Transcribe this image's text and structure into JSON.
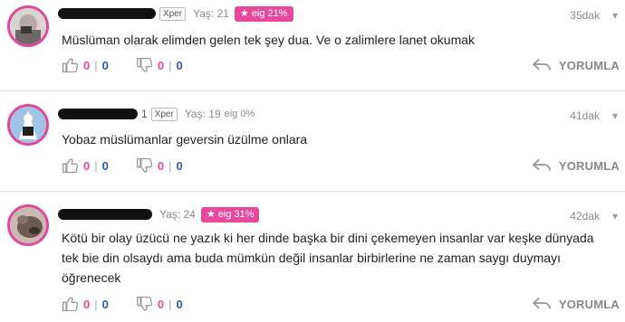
{
  "comments": [
    {
      "badge": "Xper",
      "age": "Yaş: 21",
      "eig": "eig 21%",
      "eig_style": "pill",
      "time": "35dak",
      "text": "Müslüman olarak elimden gelen tek şey dua. Ve o zalimlere lanet okumak",
      "likes": "0",
      "likes_b": "0",
      "dislikes": "0",
      "dislikes_b": "0",
      "reply": "YORUMLA"
    },
    {
      "level": "1",
      "badge": "Xper",
      "age": "Yaş: 19",
      "eig": "eig 0%",
      "eig_style": "plain",
      "time": "41dak",
      "text": "Yobaz müslümanlar geversin üzülme onlara",
      "likes": "0",
      "likes_b": "0",
      "dislikes": "0",
      "dislikes_b": "0",
      "reply": "YORUMLA"
    },
    {
      "age": "Yaş: 24",
      "eig": "eig 31%",
      "eig_style": "pill",
      "time": "42dak",
      "text": "Kötü bir olay üzücü ne yazık ki her dinde başka bir dini çekemeyen insanlar var keşke dünyada tek bie din olsaydı ama buda mümkün değil insanlar birbirlerine ne zaman saygı duymayı öğrenecek",
      "likes": "0",
      "likes_b": "0",
      "dislikes": "0",
      "dislikes_b": "0",
      "reply": "YORUMLA"
    }
  ],
  "icons": {
    "star": "★",
    "chevron": "▾",
    "like": "thumbs-up-icon",
    "dislike": "thumbs-down-icon",
    "reply": "reply-arrow-icon"
  },
  "colors": {
    "accent_pink": "#e8489b",
    "count_blue": "#2a5caa",
    "muted": "#888888"
  }
}
